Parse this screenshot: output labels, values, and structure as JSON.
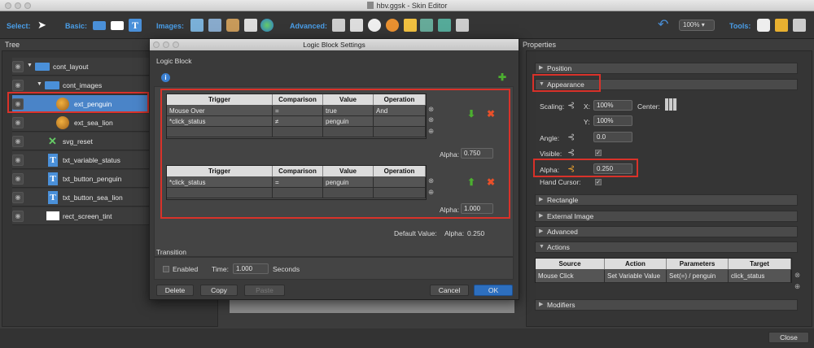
{
  "window": {
    "title": "hbv.ggsk - Skin Editor"
  },
  "toolbar": {
    "select_label": "Select:",
    "basic_label": "Basic:",
    "images_label": "Images:",
    "advanced_label": "Advanced:",
    "tools_label": "Tools:",
    "zoom": "100%"
  },
  "tree": {
    "header": "Tree",
    "items": [
      {
        "label": "cont_layout"
      },
      {
        "label": "cont_images"
      },
      {
        "label": "ext_penguin"
      },
      {
        "label": "ext_sea_lion"
      },
      {
        "label": "svg_reset"
      },
      {
        "label": "txt_variable_status"
      },
      {
        "label": "txt_button_penguin"
      },
      {
        "label": "txt_button_sea_lion"
      },
      {
        "label": "rect_screen_tint"
      }
    ]
  },
  "dialog": {
    "title": "Logic Block Settings",
    "section_label": "Logic Block",
    "info_icon": "i",
    "table_headers": [
      "Trigger",
      "Comparison",
      "Value",
      "Operation"
    ],
    "block1_rows": [
      {
        "trigger": "Mouse Over",
        "comparison": "=",
        "value": "true",
        "operation": "And"
      },
      {
        "trigger": "*click_status",
        "comparison": "≠",
        "value": "penguin",
        "operation": ""
      }
    ],
    "block1_alpha_label": "Alpha:",
    "block1_alpha": "0.750",
    "block2_rows": [
      {
        "trigger": "*click_status",
        "comparison": "=",
        "value": "penguin",
        "operation": ""
      }
    ],
    "block2_alpha_label": "Alpha:",
    "block2_alpha": "1.000",
    "default_value_label": "Default Value:",
    "default_alpha_label": "Alpha:",
    "default_alpha": "0.250",
    "transition_label": "Transition",
    "enabled_label": "Enabled",
    "time_label": "Time:",
    "time_value": "1.000",
    "seconds_label": "Seconds",
    "buttons": {
      "delete": "Delete",
      "copy": "Copy",
      "paste": "Paste",
      "cancel": "Cancel",
      "ok": "OK"
    }
  },
  "properties": {
    "header": "Properties",
    "sections": {
      "position": "Position",
      "appearance": "Appearance",
      "rectangle": "Rectangle",
      "external_image": "External Image",
      "advanced": "Advanced",
      "actions": "Actions",
      "modifiers": "Modifiers"
    },
    "scaling_label": "Scaling:",
    "x_label": "X:",
    "x_value": "100%",
    "y_label": "Y:",
    "y_value": "100%",
    "center_label": "Center:",
    "angle_label": "Angle:",
    "angle_value": "0.0",
    "visible_label": "Visible:",
    "alpha_label": "Alpha:",
    "alpha_value": "0.250",
    "hand_cursor_label": "Hand Cursor:",
    "actions_headers": [
      "Source",
      "Action",
      "Parameters",
      "Target"
    ],
    "actions_row": {
      "source": "Mouse Click",
      "action": "Set Variable Value",
      "parameters": "Set(=) / penguin",
      "target": "click_status"
    }
  },
  "bottom": {
    "close": "Close"
  },
  "colors": {
    "accent": "#4a9ee8",
    "highlight": "#d9322a",
    "selection": "#4a84c8"
  }
}
